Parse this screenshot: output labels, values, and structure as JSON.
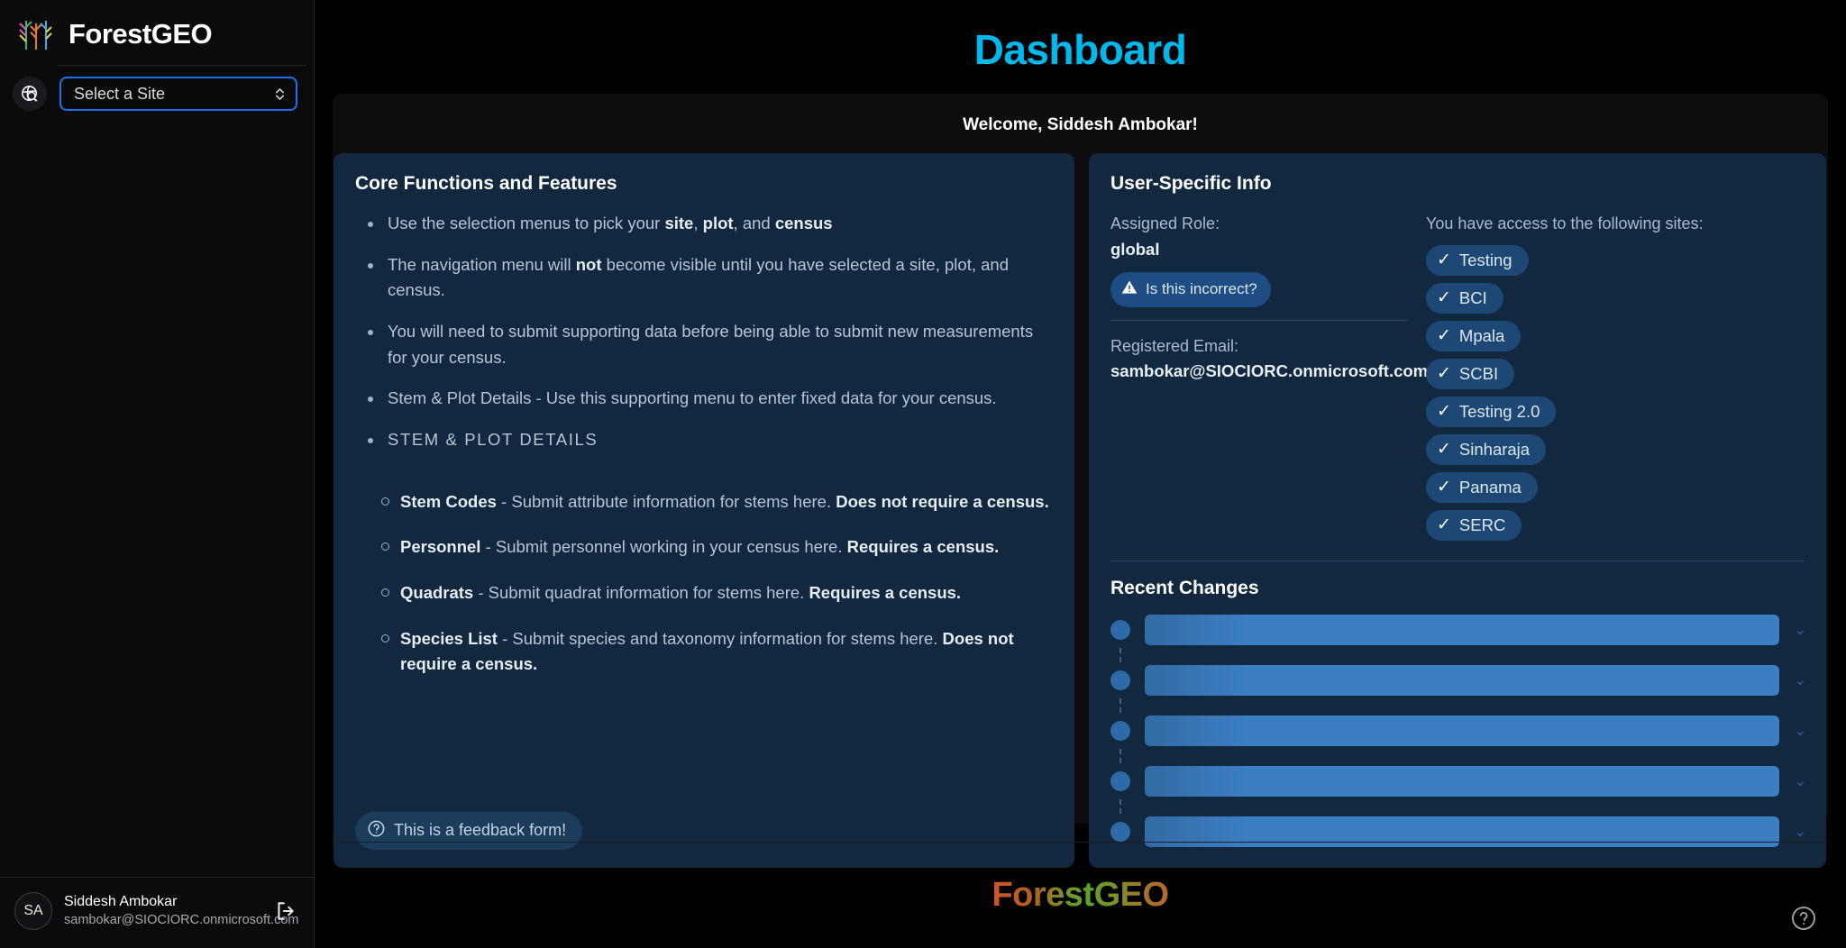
{
  "sidebar": {
    "brand_name": "ForestGEO",
    "site_select": {
      "value": "Select a Site",
      "placeholder": "Select a Site"
    },
    "user": {
      "initials": "SA",
      "name": "Siddesh Ambokar",
      "email": "sambokar@SIOCIORC.onmicrosoft.com"
    }
  },
  "header": {
    "title": "Dashboard",
    "title_color": "#00b8ec",
    "welcome": "Welcome, Siddesh Ambokar!"
  },
  "core_card": {
    "title": "Core Functions and Features",
    "bullets": [
      {
        "html": "Use the selection menus to pick your <b>site</b>, <b>plot</b>, and <b>census</b>"
      },
      {
        "html": "The navigation menu will <b>not</b> become visible until you have selected a site, plot, and census."
      },
      {
        "html": "You will need to submit supporting data before being able to submit new measurements for your census."
      },
      {
        "html": "Stem &amp; Plot Details - Use this supporting menu to enter fixed data for your census."
      }
    ],
    "section_label": "STEM & PLOT DETAILS",
    "subbullets": [
      {
        "html": "<b>Stem Codes</b> - Submit attribute information for stems here. <b>Does not require a census.</b>"
      },
      {
        "html": "<b>Personnel</b> - Submit personnel working in your census here. <b>Requires a census.</b>"
      },
      {
        "html": "<b>Quadrats</b> - Submit quadrat information for stems here. <b>Requires a census.</b>"
      },
      {
        "html": "<b>Species List</b> - Submit species and taxonomy information for stems here. <b>Does not require a census.</b>"
      }
    ],
    "feedback_label": "This is a feedback form!"
  },
  "user_card": {
    "title": "User-Specific Info",
    "role_label": "Assigned Role:",
    "role_value": "global",
    "incorrect_label": "Is this incorrect?",
    "email_label": "Registered Email:",
    "email_value": "sambokar@SIOCIORC.onmicrosoft.com",
    "sites_label": "You have access to the following sites:",
    "sites": [
      "Testing",
      "BCI",
      "Mpala",
      "SCBI",
      "Testing 2.0",
      "Sinharaja",
      "Panama",
      "SERC"
    ],
    "recent_title": "Recent Changes",
    "recent_placeholder_count": 5
  },
  "footer": {
    "logo_text": "ForestGEO"
  },
  "colors": {
    "card_bg": "#11283f",
    "chip_bg": "#1d4875",
    "accent_cyan": "#00b8ec",
    "select_border": "#1f6feb",
    "skeleton_bar": "#3b7ec2"
  }
}
